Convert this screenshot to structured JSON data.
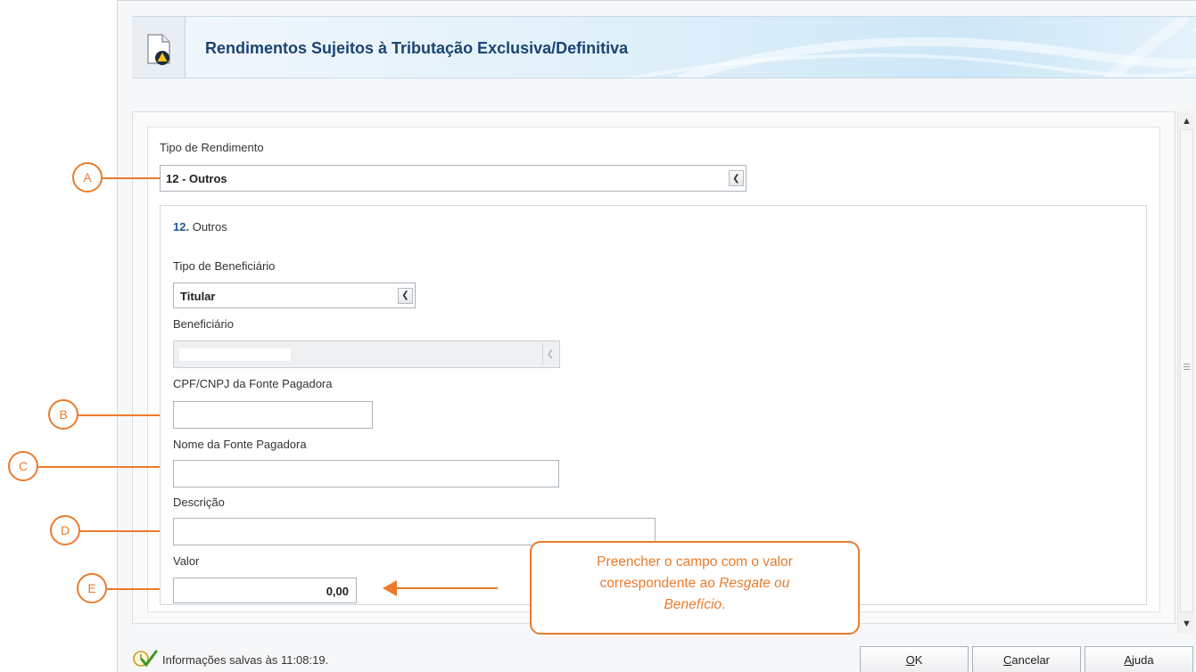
{
  "window": {
    "title": "Rendimentos Sujeitos à Tributação Exclusiva/Definitiva"
  },
  "form": {
    "tipo_rendimento_label": "Tipo de Rendimento",
    "tipo_rendimento_value": "12 - Outros",
    "section_number": "12.",
    "section_name": "Outros",
    "tipo_beneficiario_label": "Tipo de Beneficiário",
    "tipo_beneficiario_value": "Titular",
    "beneficiario_label": "Beneficiário",
    "beneficiario_value": "",
    "cpf_cnpj_label": "CPF/CNPJ da Fonte Pagadora",
    "cpf_cnpj_value": "",
    "nome_fonte_label": "Nome da Fonte Pagadora",
    "nome_fonte_value": "",
    "descricao_label": "Descrição",
    "descricao_value": "",
    "valor_label": "Valor",
    "valor_value": "0,00"
  },
  "status": {
    "message": "Informações salvas às 11:08:19."
  },
  "buttons": {
    "ok_underline": "O",
    "ok_rest": "K",
    "cancel_underline": "C",
    "cancel_rest": "ancelar",
    "help_underline": "A",
    "help_rest": "juda"
  },
  "annotations": {
    "markers": [
      "A",
      "B",
      "C",
      "D",
      "E"
    ],
    "callout_line1": "Preencher o campo com o valor",
    "callout_line2_plain": "correspondente ao ",
    "callout_line2_italic": "Resgate ou",
    "callout_line3_italic": "Benefício",
    "callout_line3_end": "."
  },
  "colors": {
    "annotation": "#ea7b2d",
    "title_text": "#1b4470",
    "section_number": "#1f5a96",
    "status_check": "#3a9a2a"
  },
  "icons": {
    "title": "document-warning-icon",
    "status": "saved-check-icon",
    "dropdown": "chevron-down-icon",
    "scroll_up": "chevron-up-icon",
    "scroll_down": "chevron-down-icon",
    "scroll_grip": "grip-icon"
  }
}
